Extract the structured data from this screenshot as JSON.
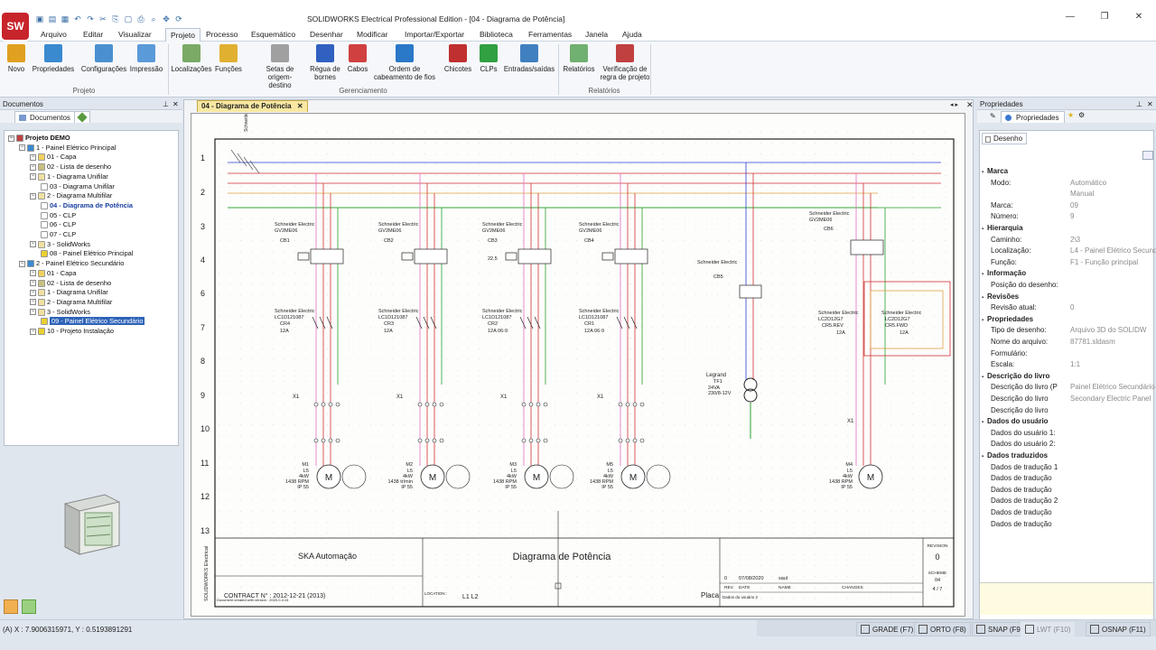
{
  "window": {
    "title": "SOLIDWORKS Electrical Professional Edition - [04 - Diagrama de Potência]",
    "logo_text": "SW"
  },
  "menu": [
    "Arquivo",
    "Editar",
    "Visualizar",
    "Projeto",
    "Processo",
    "Esquemático",
    "Desenhar",
    "Modificar",
    "Importar/Exportar",
    "Biblioteca",
    "Ferramentas",
    "Janela",
    "Ajuda"
  ],
  "menu_active": "Projeto",
  "ribbon": {
    "groups": [
      "Projeto",
      "Gerenciamento",
      "Relatórios"
    ],
    "buttons": [
      {
        "label": "Novo",
        "color": "#e0a020"
      },
      {
        "label": "Propriedades",
        "color": "#3a8ad0"
      },
      {
        "label": "Configurações",
        "color": "#4a90d0"
      },
      {
        "label": "Impressão",
        "color": "#5a9ad8"
      },
      {
        "label": "Localizações",
        "color": "#7aaa66"
      },
      {
        "label": "Funções",
        "color": "#e0b030"
      },
      {
        "label": "Setas de origem-destino",
        "color": "#a0a0a0"
      },
      {
        "label": "Régua de bornes",
        "color": "#3060c0"
      },
      {
        "label": "Cabos",
        "color": "#d04040"
      },
      {
        "label": "Ordem de cabeamento de fios",
        "color": "#2a78c8"
      },
      {
        "label": "Chicotes",
        "color": "#c03030"
      },
      {
        "label": "CLPs",
        "color": "#30a040"
      },
      {
        "label": "Entradas/saídas",
        "color": "#4080c0"
      },
      {
        "label": "Relatórios",
        "color": "#70b070"
      },
      {
        "label": "Verificação de regra de projeto",
        "color": "#c04040"
      }
    ]
  },
  "documents_panel": {
    "title": "Documentos",
    "tab": "Documentos",
    "tree": [
      {
        "label": "Projeto DEMO",
        "level": 0,
        "style": "bold",
        "icon": "#c04040"
      },
      {
        "label": "1 - Painel Elétrico Principal",
        "level": 1,
        "icon": "#3a8ad0"
      },
      {
        "label": "01 - Capa",
        "level": 2,
        "icon": "#f0d060"
      },
      {
        "label": "02 - Lista de desenho",
        "level": 2,
        "icon": "#c8c080"
      },
      {
        "label": "1 - Diagrama Unifilar",
        "level": 2,
        "icon": "#f0e0a0"
      },
      {
        "label": "03 - Diagrama Unifilar",
        "level": 3,
        "icon": "#ffffff"
      },
      {
        "label": "2 - Diagrama Multifilar",
        "level": 2,
        "icon": "#f0e0a0"
      },
      {
        "label": "04 - Diagrama de Potência",
        "level": 3,
        "style": "cur",
        "icon": "#ffffff"
      },
      {
        "label": "05 - CLP",
        "level": 3,
        "icon": "#ffffff"
      },
      {
        "label": "06 - CLP",
        "level": 3,
        "icon": "#ffffff"
      },
      {
        "label": "07 - CLP",
        "level": 3,
        "icon": "#ffffff"
      },
      {
        "label": "3 - SolidWorks",
        "level": 2,
        "icon": "#f0e0a0"
      },
      {
        "label": "08 - Painel Elétrico Principal",
        "level": 3,
        "icon": "#e8d030"
      },
      {
        "label": "2 - Painel Elétrico Secundário",
        "level": 1,
        "icon": "#3a8ad0"
      },
      {
        "label": "01 - Capa",
        "level": 2,
        "icon": "#f0d060"
      },
      {
        "label": "02 - Lista de desenho",
        "level": 2,
        "icon": "#c8c080"
      },
      {
        "label": "1 - Diagrama Unifilar",
        "level": 2,
        "icon": "#f0e0a0"
      },
      {
        "label": "2 - Diagrama Multifilar",
        "level": 2,
        "icon": "#f0e0a0"
      },
      {
        "label": "3 - SolidWorks",
        "level": 2,
        "icon": "#f0e0a0"
      },
      {
        "label": "09 - Painel Elétrico Secundário",
        "level": 3,
        "style": "sel",
        "icon": "#e8d030"
      },
      {
        "label": "10 - Projeto Instalação",
        "level": 2,
        "icon": "#e8d030"
      }
    ]
  },
  "document_tab": "04 - Diagrama de Potência",
  "drawing": {
    "row_numbers": [
      "1",
      "2",
      "3",
      "4",
      "6",
      "7",
      "8",
      "9",
      "10",
      "11",
      "12",
      "13"
    ],
    "company": "SKA Automação",
    "sheet_title": "Diagrama de Potência",
    "contract": "CONTRACT N° : 2012-12-21 (2013)",
    "location_label": "LOCATION :",
    "location_value": "L1 L2",
    "revision_label": "REVISION",
    "revision_value": "0",
    "scheme_label": "SCHEME",
    "scheme_value": "04",
    "sheet_count": "4 / 7",
    "rev_row": [
      "0",
      "07/08/2020",
      "saul"
    ],
    "rev_headers": [
      "REV.",
      "DATE",
      "NAME",
      "CHANGES"
    ],
    "placa": "Placa",
    "user_data": "Dados do usuário 2",
    "side_label": "SOLIDWORKS Electrical",
    "version_note": "Document created with version : 2020.0.4.15",
    "motors": [
      {
        "tag": "M1",
        "lines": [
          "L5",
          "4kW",
          "1438 RPM",
          "IP 55"
        ]
      },
      {
        "tag": "M2",
        "lines": [
          "L5",
          "4kW",
          "1438 tr/min",
          "IP 55"
        ]
      },
      {
        "tag": "M3",
        "lines": [
          "L5",
          "4kW",
          "1438 RPM",
          "IP 55"
        ]
      },
      {
        "tag": "M5",
        "lines": [
          "L5",
          "4kW",
          "1438 RPM",
          "IP 55"
        ]
      },
      {
        "tag": "M4",
        "lines": [
          "L5",
          "4kW",
          "1438 RPM",
          "IP 55"
        ]
      }
    ],
    "breakers": [
      {
        "brand": "Schneider Electric",
        "model": "GV2ME06",
        "tag": "CB1"
      },
      {
        "brand": "Schneider Electric",
        "model": "GV2ME06",
        "tag": "CB2"
      },
      {
        "brand": "Schneider Electric",
        "model": "GV2ME06",
        "tag": "CB3"
      },
      {
        "brand": "Schneider Electric",
        "model": "GV2ME06",
        "tag": "CB4"
      },
      {
        "brand": "Schneider Electric",
        "model": "",
        "tag": "CB5"
      },
      {
        "brand": "Schneider Electric",
        "model": "GV2ME06",
        "tag": "CB6"
      }
    ],
    "contactors": [
      {
        "brand": "Schneider Electric",
        "model": "LC1D121087",
        "tag": "CR4",
        "rating": "12A"
      },
      {
        "brand": "Schneider Electric",
        "model": "LC1D121087",
        "tag": "CR3",
        "rating": "12A"
      },
      {
        "brand": "Schneider Electric",
        "model": "LC1D121087",
        "tag": "CR2",
        "rating": "12A 06-9"
      },
      {
        "brand": "Schneider Electric",
        "model": "LC1D121087",
        "tag": "CR1",
        "rating": "12A 06-9"
      },
      {
        "brand": "Schneider Electric",
        "model": "LC2D12G7",
        "tag": "CR5.REV",
        "rating": "12A"
      },
      {
        "brand": "Schneider Electric",
        "model": "LC2D12G7",
        "tag": "CR5.FWD",
        "rating": "12A"
      }
    ],
    "transformer": {
      "brand": "Legrand",
      "tag": "TF1",
      "lines": [
        "24VA",
        "230/8-12V"
      ]
    },
    "setting": "22,5",
    "terminal_tag": "X1"
  },
  "properties_panel": {
    "title": "Propriedades",
    "tab": "Propriedades",
    "subtab": "Desenho",
    "sections": [
      {
        "title": "Marca",
        "rows": [
          [
            "Modo:",
            "Automático"
          ],
          [
            "",
            "Manual"
          ],
          [
            "Marca:",
            "09"
          ],
          [
            "Número:",
            "9"
          ]
        ]
      },
      {
        "title": "Hierarquia",
        "rows": [
          [
            "Caminho:",
            "2\\3"
          ],
          [
            "Localização:",
            "L4 - Painel Elétrico Secund"
          ],
          [
            "Função:",
            "F1 - Função principal"
          ]
        ]
      },
      {
        "title": "Informação",
        "rows": [
          [
            "Posição do desenho:",
            ""
          ]
        ]
      },
      {
        "title": "Revisões",
        "rows": [
          [
            "Revisão atual:",
            "0"
          ]
        ]
      },
      {
        "title": "Propriedades",
        "rows": [
          [
            "Tipo de desenho:",
            "Arquivo 3D do SOLIDW"
          ],
          [
            "Nome do arquivo:",
            "87781.sldasm"
          ],
          [
            "Formulário:",
            ""
          ],
          [
            "Escala:",
            "1:1"
          ]
        ]
      },
      {
        "title": "Descrição do livro",
        "rows": [
          [
            "Descrição do livro (P",
            "Painel Elétrico Secundário"
          ],
          [
            "Descrição do livro",
            "Secondary Electric Panel"
          ],
          [
            "Descrição do livro",
            ""
          ]
        ]
      },
      {
        "title": "Dados do usuário",
        "rows": [
          [
            "Dados do usuário 1:",
            ""
          ],
          [
            "Dados do usuário 2:",
            ""
          ]
        ]
      },
      {
        "title": "Dados traduzidos",
        "rows": [
          [
            "Dados de tradução 1",
            ""
          ],
          [
            "Dados de tradução",
            ""
          ],
          [
            "Dados de tradução",
            ""
          ],
          [
            "Dados de tradução 2",
            ""
          ],
          [
            "Dados de tradução",
            ""
          ],
          [
            "Dados de tradução",
            ""
          ]
        ]
      }
    ]
  },
  "status": {
    "coords": "(A) X : 7.9006315971, Y : 0.5193891291",
    "buttons": [
      {
        "label": "GRADE (F7)",
        "on": true
      },
      {
        "label": "ORTO (F8)",
        "on": true
      },
      {
        "label": "SNAP (F9)",
        "on": true
      },
      {
        "label": "LWT (F10)",
        "on": false
      },
      {
        "label": "OSNAP (F11)",
        "on": true
      }
    ]
  },
  "colors": {
    "accent": "#2e63b8",
    "wire_red": "#d03030",
    "wire_green": "#2aa02a",
    "wire_blue": "#2a3fd0",
    "wire_pink": "#e070c0",
    "wire_orange": "#e0a040"
  }
}
